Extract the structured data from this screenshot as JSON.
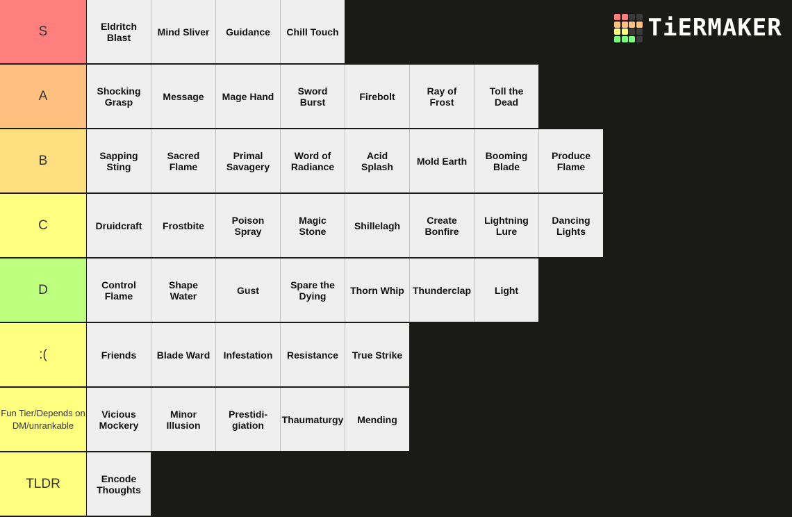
{
  "brand": {
    "name": "TiERMAKER",
    "grid_colors": [
      [
        "#ff7f7f",
        "#ff7f7f",
        "#3a3a3a",
        "#3a3a3a"
      ],
      [
        "#ffbf7f",
        "#ffbf7f",
        "#ffbf7f",
        "#ffbf7f"
      ],
      [
        "#ffff7f",
        "#ffff7f",
        "#3a3a3a",
        "#3a3a3a"
      ],
      [
        "#7fff7f",
        "#7fff7f",
        "#7fff7f",
        "#3a3a3a"
      ]
    ]
  },
  "tiers": [
    {
      "label": "S",
      "color": "#ff7f7f",
      "items": [
        "Eldritch\nBlast",
        "Mind Sliver",
        "Guidance",
        "Chill Touch"
      ]
    },
    {
      "label": "A",
      "color": "#ffbf7f",
      "items": [
        "Shocking\nGrasp",
        "Message",
        "Mage Hand",
        "Sword\nBurst",
        "Firebolt",
        "Ray of\nFrost",
        "Toll the\nDead"
      ]
    },
    {
      "label": "B",
      "color": "#ffdf7f",
      "items": [
        "Sapping\nSting",
        "Sacred\nFlame",
        "Primal\nSavagery",
        "Word of\nRadiance",
        "Acid\nSplash",
        "Mold Earth",
        "Booming\nBlade",
        "Produce\nFlame"
      ]
    },
    {
      "label": "C",
      "color": "#ffff7f",
      "items": [
        "Druidcraft",
        "Frostbite",
        "Poison\nSpray",
        "Magic\nStone",
        "Shillelagh",
        "Create\nBonfire",
        "Lightning\nLure",
        "Dancing\nLights"
      ]
    },
    {
      "label": "D",
      "color": "#bfff7f",
      "items": [
        "Control\nFlame",
        "Shape\nWater",
        "Gust",
        "Spare the\nDying",
        "Thorn Whip",
        "Thunderclap",
        "Light"
      ]
    },
    {
      "label": ":(",
      "color": "#ffff7f",
      "items": [
        "Friends",
        "Blade Ward",
        "Infestation",
        "Resistance",
        "True Strike"
      ]
    },
    {
      "label": "Fun Tier/Depends on DM/unrankable",
      "color": "#ffff7f",
      "items": [
        "Vicious\nMockery",
        "Minor\nIllusion",
        "Prestidi-\ngiation",
        "Thaumaturgy",
        "Mending"
      ]
    },
    {
      "label": "TLDR",
      "color": "#ffff7f",
      "items": [
        "Encode\nThoughts"
      ]
    }
  ]
}
